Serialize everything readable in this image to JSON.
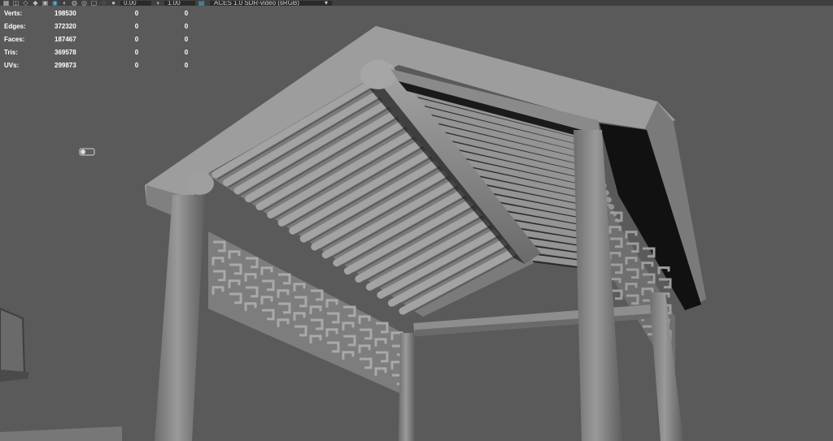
{
  "toolbar": {
    "icons": [
      "grid-icon",
      "camera-icon",
      "wireframe-icon",
      "smooth-shade-icon",
      "texture-icon",
      "light-icon",
      "shadow-icon",
      "ao-icon",
      "aa-icon",
      "isolate-icon",
      "xray-icon",
      "gamma-icon"
    ],
    "exposure_value": "0.00",
    "gamma_value": "1.00",
    "colorspace_label": "ACES 1.0 SDR-video (sRGB)"
  },
  "hud": {
    "rows": [
      {
        "label": "Verts:",
        "v1": "198530",
        "v2": "0",
        "v3": "0"
      },
      {
        "label": "Edges:",
        "v1": "372320",
        "v2": "0",
        "v3": "0"
      },
      {
        "label": "Faces:",
        "v1": "187467",
        "v2": "0",
        "v3": "0"
      },
      {
        "label": "Tris:",
        "v1": "369578",
        "v2": "0",
        "v3": "0"
      },
      {
        "label": "UVs:",
        "v1": "299873",
        "v2": "0",
        "v3": "0"
      }
    ]
  },
  "colors": {
    "background": "#5a5a5a",
    "roof_top": "#9c9c9c",
    "roof_edge": "#828282",
    "rafter": "#8f8f8f",
    "shadow": "#111111",
    "accent": "#49b7e6"
  }
}
